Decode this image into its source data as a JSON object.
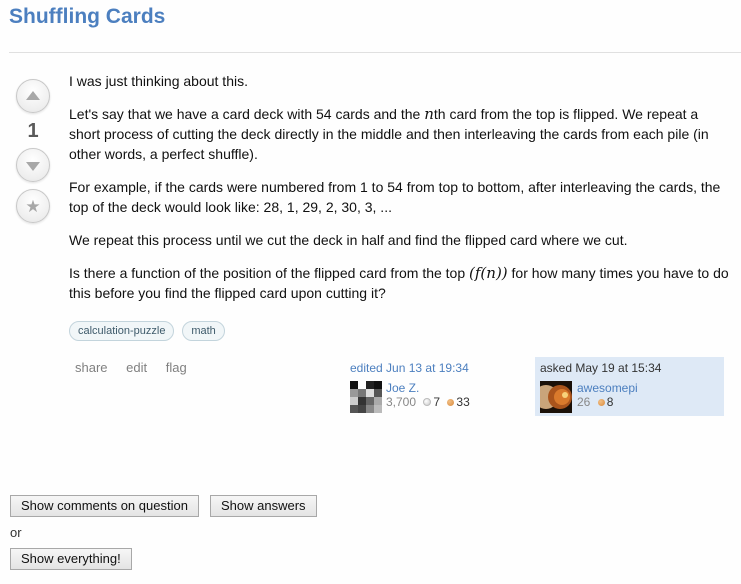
{
  "question": {
    "title": "Shuffling Cards",
    "vote_count": "1",
    "paragraphs": {
      "p1": "I was just thinking about this.",
      "p2a": "Let's say that we have a card deck with 54 cards and the ",
      "p2_math": "n",
      "p2b": "th card from the top is flipped. We repeat a short process of cutting the deck directly in the middle and then interleaving the cards from each pile (in other words, a perfect shuffle).",
      "p3": "For example, if the cards were numbered from 1 to 54 from top to bottom, after interleaving the cards, the top of the deck would look like: 28, 1, 29, 2, 30, 3, ...",
      "p4": "We repeat this process until we cut the deck in half and find the flipped card where we cut.",
      "p5a": "Is there a function of the position of the flipped card from the top ",
      "p5_math": "(f(n))",
      "p5b": " for how many times you have to do this before you find the flipped card upon cutting it?"
    },
    "tags": [
      "calculation-puzzle",
      "math"
    ],
    "actions": {
      "share": "share",
      "edit": "edit",
      "flag": "flag"
    },
    "edited": {
      "label": "edited Jun 13 at 19:34",
      "user": "Joe Z.",
      "reputation": "3,700",
      "silver": "7",
      "bronze": "33"
    },
    "asked": {
      "label": "asked May 19 at 15:34",
      "user": "awesomepi",
      "reputation": "26",
      "bronze": "8"
    }
  },
  "controls": {
    "show_comments": "Show comments on question",
    "show_answers": "Show answers",
    "or": "or",
    "show_everything": "Show everything!"
  },
  "icons": {
    "upvote": "triangle-up-icon",
    "downvote": "triangle-down-icon",
    "favorite": "star-icon"
  }
}
